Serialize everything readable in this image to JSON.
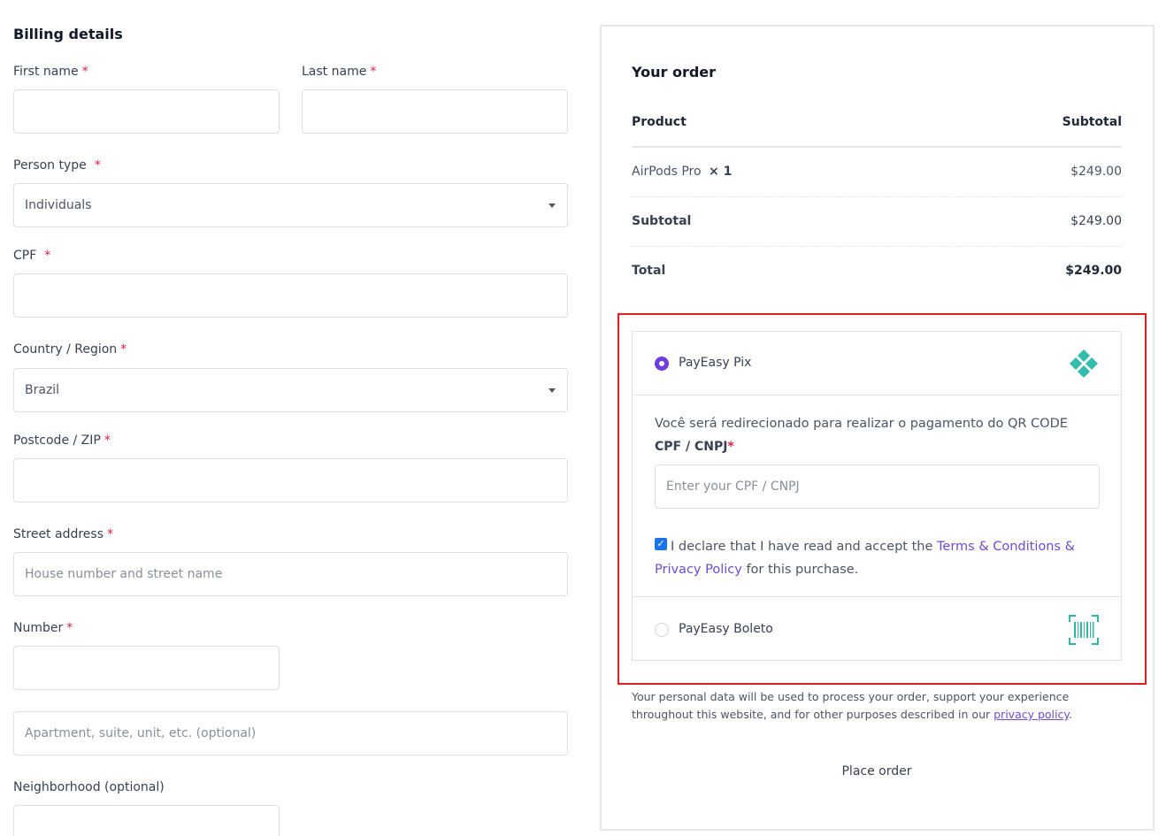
{
  "billing": {
    "title": "Billing details",
    "required_mark": "*",
    "first_name": {
      "label": "First name",
      "value": "",
      "placeholder": ""
    },
    "last_name": {
      "label": "Last name",
      "value": "",
      "placeholder": ""
    },
    "person_type": {
      "label": "Person type",
      "selected": "Individuals"
    },
    "cpf": {
      "label": "CPF",
      "value": "",
      "placeholder": ""
    },
    "country": {
      "label": "Country / Region",
      "selected": "Brazil"
    },
    "postcode": {
      "label": "Postcode / ZIP",
      "value": "",
      "placeholder": ""
    },
    "street": {
      "label": "Street address",
      "value": "",
      "placeholder": "House number and street name"
    },
    "number": {
      "label": "Number",
      "value": "",
      "placeholder": ""
    },
    "apartment": {
      "value": "",
      "placeholder": "Apartment, suite, unit, etc. (optional)"
    },
    "neighborhood": {
      "label": "Neighborhood (optional)",
      "value": "",
      "placeholder": ""
    }
  },
  "order": {
    "title": "Your order",
    "col_product": "Product",
    "col_subtotal": "Subtotal",
    "item_name": "AirPods Pro",
    "item_qty": "× 1",
    "item_price": "$249.00",
    "subtotal_label": "Subtotal",
    "subtotal_value": "$249.00",
    "total_label": "Total",
    "total_value": "$249.00"
  },
  "payment": {
    "pix": {
      "name": "PayEasy Pix",
      "selected": true,
      "icon": "pix-icon",
      "description": "Você será redirecionado para realizar o pagamento do QR CODE",
      "cpf_label": "CPF / CNPJ",
      "cpf_required": "*",
      "cpf_placeholder": "Enter your CPF / CNPJ",
      "declare_checked": true,
      "declare_prefix": "I declare that I have read and accept the",
      "declare_link": "Terms & Conditions & Privacy Policy",
      "declare_suffix": "for this purchase."
    },
    "boleto": {
      "name": "PayEasy Boleto",
      "selected": false,
      "icon": "barcode-icon"
    }
  },
  "privacy": {
    "text": "Your personal data will be used to process your order, support your experience throughout this website, and for other purposes described in our",
    "link": "privacy policy",
    "end": "."
  },
  "place_order_label": "Place order",
  "colors": {
    "accent": "#6d3de0",
    "link": "#6d4bd8",
    "required": "#e11d48",
    "pix_teal": "#32bcad",
    "highlight_red": "#e11d1d"
  }
}
